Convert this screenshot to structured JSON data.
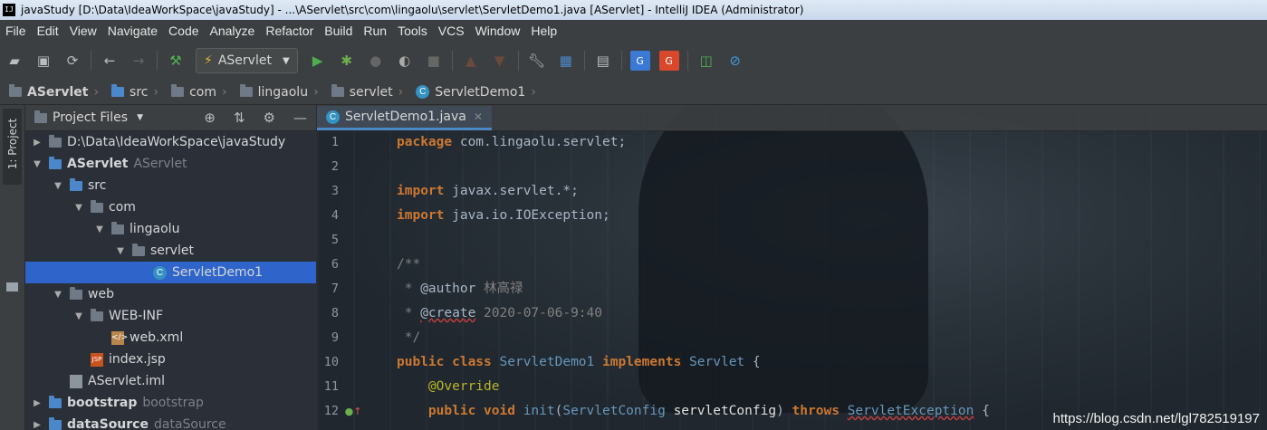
{
  "window": {
    "title": "javaStudy [D:\\Data\\IdeaWorkSpace\\javaStudy] - ...\\AServlet\\src\\com\\lingaolu\\servlet\\ServletDemo1.java [AServlet] - IntelliJ IDEA (Administrator)",
    "app_badge": "IJ"
  },
  "menu": [
    "File",
    "Edit",
    "View",
    "Navigate",
    "Code",
    "Analyze",
    "Refactor",
    "Build",
    "Run",
    "Tools",
    "VCS",
    "Window",
    "Help"
  ],
  "toolbar": {
    "run_config": "AServlet"
  },
  "breadcrumb": [
    "AServlet",
    "src",
    "com",
    "lingaolu",
    "servlet",
    "ServletDemo1"
  ],
  "side_tab": "1: Project",
  "project_panel": {
    "title": "Project Files",
    "tree": [
      {
        "indent": 0,
        "arrow": "▶",
        "icon": "folder",
        "label": "D:\\Data\\IdeaWorkSpace\\javaStudy",
        "muted": ""
      },
      {
        "indent": 0,
        "arrow": "▼",
        "icon": "module",
        "label": "AServlet",
        "muted": "AServlet",
        "bold": true
      },
      {
        "indent": 1,
        "arrow": "▼",
        "icon": "src",
        "label": "src",
        "muted": ""
      },
      {
        "indent": 2,
        "arrow": "▼",
        "icon": "folder",
        "label": "com",
        "muted": ""
      },
      {
        "indent": 3,
        "arrow": "▼",
        "icon": "folder",
        "label": "lingaolu",
        "muted": ""
      },
      {
        "indent": 4,
        "arrow": "▼",
        "icon": "folder",
        "label": "servlet",
        "muted": ""
      },
      {
        "indent": 5,
        "arrow": "",
        "icon": "class",
        "label": "ServletDemo1",
        "muted": "",
        "selected": true
      },
      {
        "indent": 1,
        "arrow": "▼",
        "icon": "folder",
        "label": "web",
        "muted": ""
      },
      {
        "indent": 2,
        "arrow": "▼",
        "icon": "folder",
        "label": "WEB-INF",
        "muted": ""
      },
      {
        "indent": 3,
        "arrow": "",
        "icon": "xml",
        "label": "web.xml",
        "muted": ""
      },
      {
        "indent": 2,
        "arrow": "",
        "icon": "jsp",
        "label": "index.jsp",
        "muted": ""
      },
      {
        "indent": 1,
        "arrow": "",
        "icon": "iml",
        "label": "AServlet.iml",
        "muted": ""
      },
      {
        "indent": 0,
        "arrow": "▶",
        "icon": "module",
        "label": "bootstrap",
        "muted": "bootstrap",
        "bold": true
      },
      {
        "indent": 0,
        "arrow": "▶",
        "icon": "module",
        "label": "dataSource",
        "muted": "dataSource",
        "bold": true
      }
    ]
  },
  "editor": {
    "tab": "ServletDemo1.java",
    "lines": [
      {
        "n": "1",
        "html": "<span class='kw'>package</span> <span class='pk'>com.lingaolu.servlet</span><span class='pk'>;</span>"
      },
      {
        "n": "2",
        "html": ""
      },
      {
        "n": "3",
        "html": "<span class='kw'>import</span> <span class='pk'>javax.servlet.*</span><span class='pk'>;</span>"
      },
      {
        "n": "4",
        "html": "<span class='kw'>import</span> <span class='pk'>java.io.IOException</span><span class='pk'>;</span>"
      },
      {
        "n": "5",
        "html": ""
      },
      {
        "n": "6",
        "html": "<span class='cm'>/**</span>"
      },
      {
        "n": "7",
        "html": "<span class='cm'> * </span><span class='cmtag'>@author</span><span class='cm'> 林高禄</span>"
      },
      {
        "n": "8",
        "html": "<span class='cm'> * </span><span class='cmtag wavy'>@create</span><span class='cm'> 2020-07-06-9:40</span>"
      },
      {
        "n": "9",
        "html": "<span class='cm'> */</span>"
      },
      {
        "n": "10",
        "html": "<span class='kw'>public class</span> <span class='typ'>ServletDemo1</span> <span class='kw'>implements</span> <span class='typ'>Servlet</span> <span class='pk'>{</span>"
      },
      {
        "n": "11",
        "html": "    <span class='ann'>@Override</span>"
      },
      {
        "n": "12",
        "html": "    <span class='kw'>public void</span> <span class='typ'>init</span><span class='pk'>(</span><span class='typ'>ServletConfig</span> <span class='ident'>servletConfig</span><span class='pk'>)</span> <span class='kw'>throws</span> <span class='typ wavy'>ServletException</span> <span class='pk'>{</span>"
      }
    ]
  },
  "watermark": "https://blog.csdn.net/lgl782519197"
}
